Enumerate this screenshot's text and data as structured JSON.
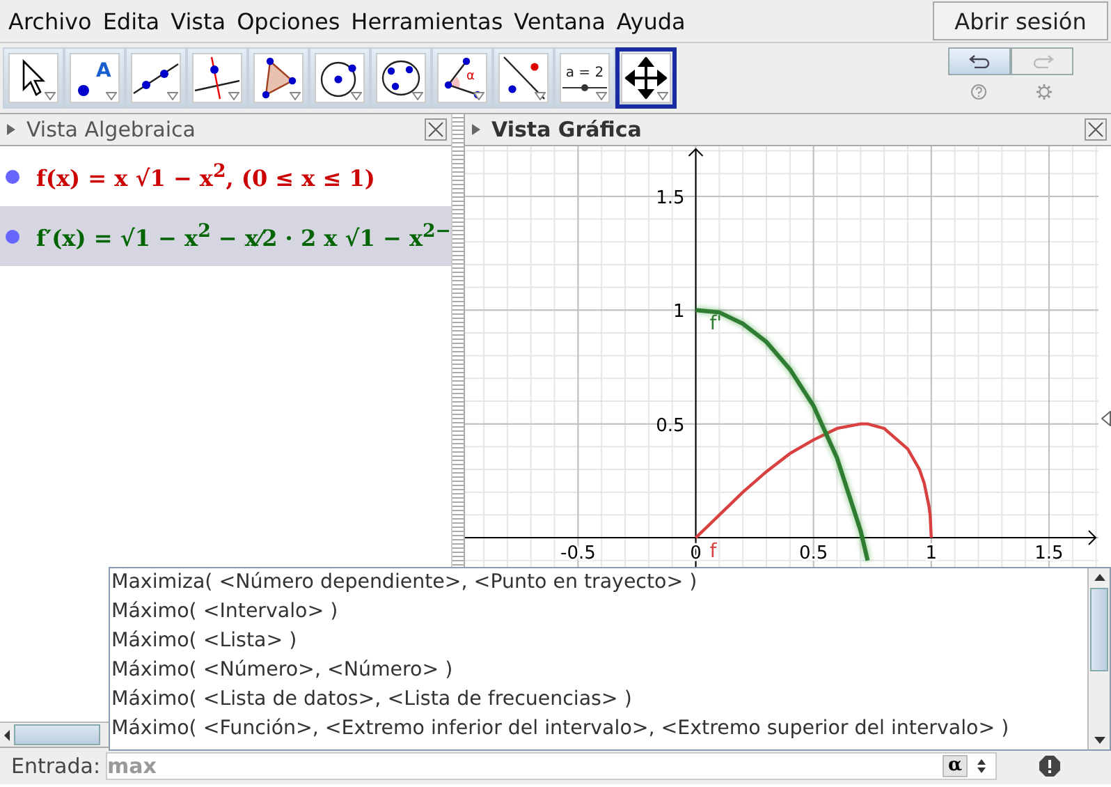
{
  "menu": [
    "Archivo",
    "Edita",
    "Vista",
    "Opciones",
    "Herramientas",
    "Ventana",
    "Ayuda"
  ],
  "login_button": "Abrir sesión",
  "tools": [
    {
      "kind": "pointer",
      "selected": false
    },
    {
      "kind": "point",
      "selected": false
    },
    {
      "kind": "line",
      "selected": false
    },
    {
      "kind": "perpendicular",
      "selected": false
    },
    {
      "kind": "polygon",
      "selected": false
    },
    {
      "kind": "circle",
      "selected": false
    },
    {
      "kind": "conic",
      "selected": false
    },
    {
      "kind": "angle",
      "selected": false
    },
    {
      "kind": "reflect",
      "selected": false
    },
    {
      "kind": "slider",
      "selected": false
    },
    {
      "kind": "move",
      "selected": true
    }
  ],
  "slider_tool_label": "a = 2",
  "point_tool_label": "A",
  "angle_tool_label": "α",
  "undo": {
    "disabled": false
  },
  "redo": {
    "disabled": true
  },
  "algebra_view": {
    "title": "Vista Algebraica",
    "items": [
      {
        "formula": "f(x) = x √1 − x$^{2}$,   (0 ≤ x ≤ 1)",
        "color": "#cc0000",
        "selected": false
      },
      {
        "formula": "f′(x) = √1 − x$^{2}$ − x⁄2 · 2 x √1 − x$^{2}$$^{−}$",
        "color": "#006400",
        "selected": true
      }
    ]
  },
  "graphics_view": {
    "title": "Vista Gráfica",
    "chart_data": {
      "type": "line",
      "x": [
        0,
        0.1,
        0.2,
        0.3,
        0.4,
        0.5,
        0.6,
        0.7,
        0.73,
        0.8,
        0.9,
        0.95,
        0.97,
        0.99,
        0.995,
        1
      ],
      "series": [
        {
          "name": "f",
          "color": "#d94040",
          "values": [
            0,
            0.1,
            0.2,
            0.29,
            0.37,
            0.43,
            0.48,
            0.5,
            0.5,
            0.48,
            0.39,
            0.3,
            0.24,
            0.14,
            0.1,
            0
          ]
        },
        {
          "name": "f'",
          "color": "#2e7d32",
          "values": [
            1,
            0.99,
            0.94,
            0.86,
            0.74,
            0.58,
            0.35,
            0.03,
            -0.1,
            null,
            null,
            null,
            null,
            null,
            null,
            null
          ]
        }
      ],
      "xlim": [
        -0.98,
        1.71
      ],
      "ylim": [
        -0.82,
        1.72
      ],
      "xticks": [
        -0.5,
        0,
        0.5,
        1,
        1.5
      ],
      "yticks": [
        0.5,
        1,
        1.5
      ],
      "grid": true
    }
  },
  "input_bar": {
    "label": "Entrada:",
    "value": "max",
    "alpha_button": "α"
  },
  "autocomplete": [
    "Maximiza( <Número dependiente>, <Punto en trayecto> )",
    "Máximo( <Intervalo> )",
    "Máximo( <Lista> )",
    "Máximo( <Número>, <Número> )",
    "Máximo( <Lista de datos>, <Lista de frecuencias> )",
    "Máximo( <Función>, <Extremo inferior del intervalo>, <Extremo superior del intervalo> )"
  ]
}
